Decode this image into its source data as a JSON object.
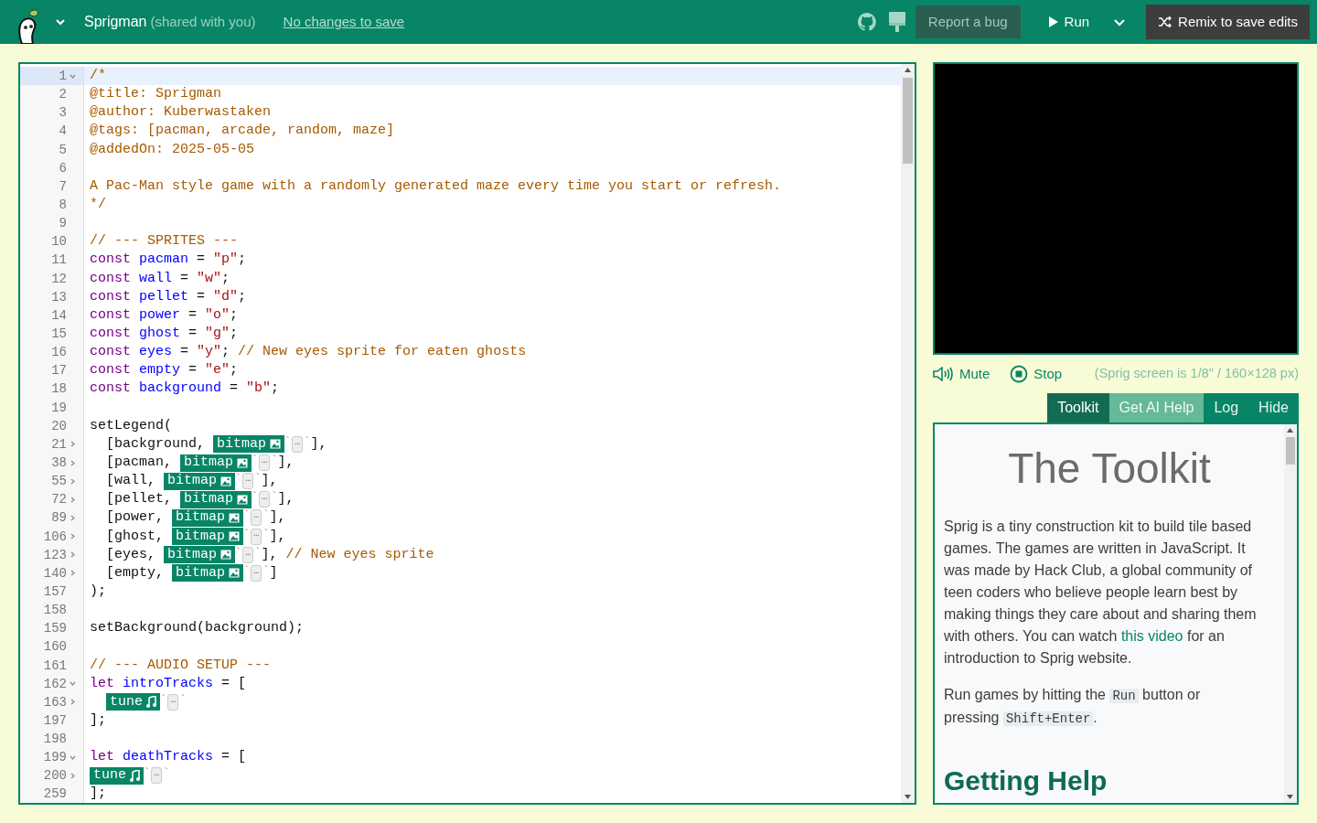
{
  "header": {
    "title": "Sprigman",
    "shared_note": "(shared with you)",
    "save_status": "No changes to save",
    "buttons": [
      {
        "kind": "report",
        "label": "Report a bug"
      },
      {
        "kind": "run",
        "label": "Run"
      },
      {
        "kind": "remix",
        "label": "Remix to save edits"
      }
    ]
  },
  "editor": {
    "lines": [
      {
        "n": "1",
        "expanded": true,
        "current": true,
        "tokens": [
          {
            "kind": "comment",
            "text": "/*"
          }
        ]
      },
      {
        "n": "2",
        "current": false,
        "tokens": [
          {
            "kind": "comment",
            "text": "@title: Sprigman"
          }
        ]
      },
      {
        "n": "3",
        "current": false,
        "tokens": [
          {
            "kind": "comment",
            "text": "@author: Kuberwastaken"
          }
        ]
      },
      {
        "n": "4",
        "current": false,
        "tokens": [
          {
            "kind": "comment",
            "text": "@tags: [pacman, arcade, random, maze]"
          }
        ]
      },
      {
        "n": "5",
        "current": false,
        "tokens": [
          {
            "kind": "comment",
            "text": "@addedOn: 2025-05-05"
          }
        ]
      },
      {
        "n": "6",
        "current": false
      },
      {
        "n": "7",
        "current": false,
        "tokens": [
          {
            "kind": "comment",
            "text": "A Pac-Man style game with a randomly generated maze every time you start or refresh."
          }
        ]
      },
      {
        "n": "8",
        "current": false,
        "tokens": [
          {
            "kind": "comment",
            "text": "*/"
          }
        ]
      },
      {
        "n": "9",
        "current": false
      },
      {
        "n": "10",
        "current": false,
        "tokens": [
          {
            "kind": "comment",
            "text": "// --- SPRITES ---"
          }
        ]
      },
      {
        "n": "11",
        "current": false,
        "tokens": [
          {
            "kind": "keyword",
            "text": "const"
          },
          {
            "kind": "def",
            "text": " pacman"
          },
          {
            "kind": "plain",
            "text": " = "
          },
          {
            "kind": "string",
            "text": "\"p\""
          },
          {
            "kind": "plain",
            "text": ";"
          }
        ]
      },
      {
        "n": "12",
        "current": false,
        "tokens": [
          {
            "kind": "keyword",
            "text": "const"
          },
          {
            "kind": "def",
            "text": " wall"
          },
          {
            "kind": "plain",
            "text": " = "
          },
          {
            "kind": "string",
            "text": "\"w\""
          },
          {
            "kind": "plain",
            "text": ";"
          }
        ]
      },
      {
        "n": "13",
        "current": false,
        "tokens": [
          {
            "kind": "keyword",
            "text": "const"
          },
          {
            "kind": "def",
            "text": " pellet"
          },
          {
            "kind": "plain",
            "text": " = "
          },
          {
            "kind": "string",
            "text": "\"d\""
          },
          {
            "kind": "plain",
            "text": ";"
          }
        ]
      },
      {
        "n": "14",
        "current": false,
        "tokens": [
          {
            "kind": "keyword",
            "text": "const"
          },
          {
            "kind": "def",
            "text": " power"
          },
          {
            "kind": "plain",
            "text": " = "
          },
          {
            "kind": "string",
            "text": "\"o\""
          },
          {
            "kind": "plain",
            "text": ";"
          }
        ]
      },
      {
        "n": "15",
        "current": false,
        "tokens": [
          {
            "kind": "keyword",
            "text": "const"
          },
          {
            "kind": "def",
            "text": " ghost"
          },
          {
            "kind": "plain",
            "text": " = "
          },
          {
            "kind": "string",
            "text": "\"g\""
          },
          {
            "kind": "plain",
            "text": ";"
          }
        ]
      },
      {
        "n": "16",
        "current": false,
        "tokens": [
          {
            "kind": "keyword",
            "text": "const"
          },
          {
            "kind": "def",
            "text": " eyes"
          },
          {
            "kind": "plain",
            "text": " = "
          },
          {
            "kind": "string",
            "text": "\"y\""
          },
          {
            "kind": "plain",
            "text": ";"
          },
          {
            "kind": "comment",
            "text": " // New eyes sprite for eaten ghosts"
          }
        ]
      },
      {
        "n": "17",
        "current": false,
        "tokens": [
          {
            "kind": "keyword",
            "text": "const"
          },
          {
            "kind": "def",
            "text": " empty"
          },
          {
            "kind": "plain",
            "text": " = "
          },
          {
            "kind": "string",
            "text": "\"e\""
          },
          {
            "kind": "plain",
            "text": ";"
          }
        ]
      },
      {
        "n": "18",
        "current": false,
        "tokens": [
          {
            "kind": "keyword",
            "text": "const"
          },
          {
            "kind": "def",
            "text": " background"
          },
          {
            "kind": "plain",
            "text": " = "
          },
          {
            "kind": "string",
            "text": "\"b\""
          },
          {
            "kind": "plain",
            "text": ";"
          }
        ]
      },
      {
        "n": "19",
        "current": false
      },
      {
        "n": "20",
        "current": false,
        "tokens": [
          {
            "kind": "plain",
            "text": "setLegend("
          }
        ]
      },
      {
        "n": "21",
        "expanded": false,
        "current": false,
        "tokens": [
          {
            "kind": "plain",
            "text": "  [background, "
          },
          {
            "kind": "bitmap",
            "text": "bitmap"
          },
          {
            "kind": "backtick",
            "text": "`"
          },
          {
            "kind": "ellipsis",
            "text": "…"
          },
          {
            "kind": "backtick",
            "text": "`"
          },
          {
            "kind": "plain",
            "text": "],"
          }
        ]
      },
      {
        "n": "38",
        "expanded": false,
        "current": false,
        "tokens": [
          {
            "kind": "plain",
            "text": "  [pacman, "
          },
          {
            "kind": "bitmap",
            "text": "bitmap"
          },
          {
            "kind": "backtick",
            "text": "`"
          },
          {
            "kind": "ellipsis",
            "text": "…"
          },
          {
            "kind": "backtick",
            "text": "`"
          },
          {
            "kind": "plain",
            "text": "],"
          }
        ]
      },
      {
        "n": "55",
        "expanded": false,
        "current": false,
        "tokens": [
          {
            "kind": "plain",
            "text": "  [wall, "
          },
          {
            "kind": "bitmap",
            "text": "bitmap"
          },
          {
            "kind": "backtick",
            "text": "`"
          },
          {
            "kind": "ellipsis",
            "text": "…"
          },
          {
            "kind": "backtick",
            "text": "`"
          },
          {
            "kind": "plain",
            "text": "],"
          }
        ]
      },
      {
        "n": "72",
        "expanded": false,
        "current": false,
        "tokens": [
          {
            "kind": "plain",
            "text": "  [pellet, "
          },
          {
            "kind": "bitmap",
            "text": "bitmap"
          },
          {
            "kind": "backtick",
            "text": "`"
          },
          {
            "kind": "ellipsis",
            "text": "…"
          },
          {
            "kind": "backtick",
            "text": "`"
          },
          {
            "kind": "plain",
            "text": "],"
          }
        ]
      },
      {
        "n": "89",
        "expanded": false,
        "current": false,
        "tokens": [
          {
            "kind": "plain",
            "text": "  [power, "
          },
          {
            "kind": "bitmap",
            "text": "bitmap"
          },
          {
            "kind": "backtick",
            "text": "`"
          },
          {
            "kind": "ellipsis",
            "text": "…"
          },
          {
            "kind": "backtick",
            "text": "`"
          },
          {
            "kind": "plain",
            "text": "],"
          }
        ]
      },
      {
        "n": "106",
        "expanded": false,
        "current": false,
        "tokens": [
          {
            "kind": "plain",
            "text": "  [ghost, "
          },
          {
            "kind": "bitmap",
            "text": "bitmap"
          },
          {
            "kind": "backtick",
            "text": "`"
          },
          {
            "kind": "ellipsis",
            "text": "…"
          },
          {
            "kind": "backtick",
            "text": "`"
          },
          {
            "kind": "plain",
            "text": "],"
          }
        ]
      },
      {
        "n": "123",
        "expanded": false,
        "current": false,
        "tokens": [
          {
            "kind": "plain",
            "text": "  [eyes, "
          },
          {
            "kind": "bitmap",
            "text": "bitmap"
          },
          {
            "kind": "backtick",
            "text": "`"
          },
          {
            "kind": "ellipsis",
            "text": "…"
          },
          {
            "kind": "backtick",
            "text": "`"
          },
          {
            "kind": "plain",
            "text": "],"
          },
          {
            "kind": "comment",
            "text": " // New eyes sprite"
          }
        ]
      },
      {
        "n": "140",
        "expanded": false,
        "current": false,
        "tokens": [
          {
            "kind": "plain",
            "text": "  [empty, "
          },
          {
            "kind": "bitmap",
            "text": "bitmap"
          },
          {
            "kind": "backtick",
            "text": "`"
          },
          {
            "kind": "ellipsis",
            "text": "…"
          },
          {
            "kind": "backtick",
            "text": "`"
          },
          {
            "kind": "plain",
            "text": "]"
          }
        ]
      },
      {
        "n": "157",
        "current": false,
        "tokens": [
          {
            "kind": "plain",
            "text": ");"
          }
        ]
      },
      {
        "n": "158",
        "current": false
      },
      {
        "n": "159",
        "current": false,
        "tokens": [
          {
            "kind": "plain",
            "text": "setBackground(background);"
          }
        ]
      },
      {
        "n": "160",
        "current": false
      },
      {
        "n": "161",
        "current": false,
        "tokens": [
          {
            "kind": "comment",
            "text": "// --- AUDIO SETUP ---"
          }
        ]
      },
      {
        "n": "162",
        "expanded": true,
        "current": false,
        "tokens": [
          {
            "kind": "keyword",
            "text": "let"
          },
          {
            "kind": "def",
            "text": " introTracks"
          },
          {
            "kind": "plain",
            "text": " = ["
          }
        ]
      },
      {
        "n": "163",
        "expanded": false,
        "current": false,
        "tokens": [
          {
            "kind": "indented-tune",
            "text": "tune"
          },
          {
            "kind": "backtick",
            "text": "`"
          },
          {
            "kind": "ellipsis",
            "text": "…"
          },
          {
            "kind": "backtick",
            "text": "`"
          }
        ]
      },
      {
        "n": "197",
        "current": false,
        "tokens": [
          {
            "kind": "plain",
            "text": "];"
          }
        ]
      },
      {
        "n": "198",
        "current": false
      },
      {
        "n": "199",
        "expanded": true,
        "current": false,
        "tokens": [
          {
            "kind": "keyword",
            "text": "let"
          },
          {
            "kind": "def",
            "text": " deathTracks"
          },
          {
            "kind": "plain",
            "text": " = ["
          }
        ]
      },
      {
        "n": "200",
        "expanded": false,
        "current": false,
        "tokens": [
          {
            "kind": "tune",
            "text": "tune"
          },
          {
            "kind": "backtick",
            "text": "`"
          },
          {
            "kind": "ellipsis",
            "text": "…"
          },
          {
            "kind": "backtick",
            "text": "`"
          }
        ]
      },
      {
        "n": "259",
        "current": false,
        "tokens": [
          {
            "kind": "plain",
            "text": "];"
          }
        ]
      }
    ]
  },
  "game_controls": [
    {
      "kind": "mute",
      "label": "Mute"
    },
    {
      "kind": "stop",
      "label": "Stop"
    }
  ],
  "screen_note": "(Sprig screen is 1/8\" / 160×128 px)",
  "tabs": [
    {
      "label": "Toolkit",
      "selected": true,
      "highlighted": false
    },
    {
      "label": "Get AI Help",
      "selected": false,
      "highlighted": true
    },
    {
      "label": "Log",
      "selected": false,
      "highlighted": false
    },
    {
      "label": "Hide",
      "selected": false,
      "highlighted": false
    }
  ],
  "toolkit": {
    "title": "The Toolkit",
    "paragraphs": [
      [
        {
          "kind": "text",
          "text": "Sprig is a tiny construction kit to build tile based games. The games are written in JavaScript. It was made by Hack Club, a global community of teen coders who believe people learn best by making things they care about and sharing them with others. You can watch "
        },
        {
          "kind": "link",
          "text": "this video"
        },
        {
          "kind": "text",
          "text": " for an introduction to Sprig website."
        }
      ],
      [
        {
          "kind": "text",
          "text": "Run games by hitting the "
        },
        {
          "kind": "code",
          "text": "Run"
        },
        {
          "kind": "text",
          "text": " button or pressing "
        },
        {
          "kind": "code",
          "text": "Shift+Enter"
        },
        {
          "kind": "text",
          "text": "."
        }
      ]
    ],
    "subheading": "Getting Help"
  }
}
